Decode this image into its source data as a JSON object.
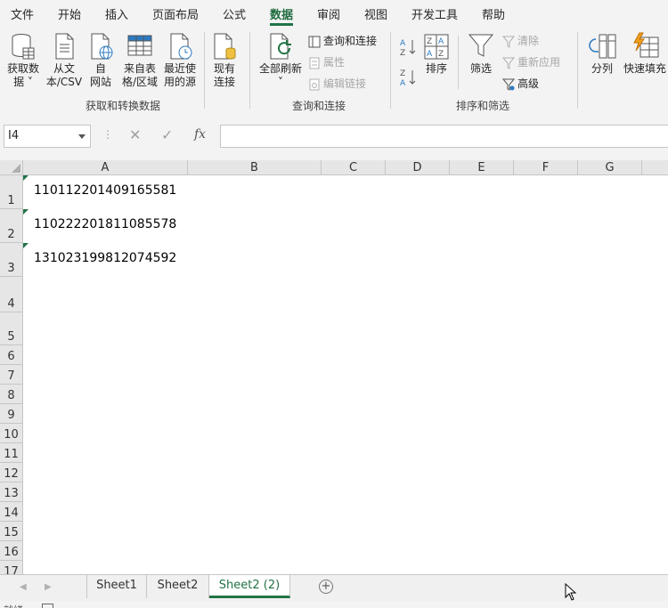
{
  "menu": {
    "tabs": [
      {
        "label": "文件"
      },
      {
        "label": "开始"
      },
      {
        "label": "插入"
      },
      {
        "label": "页面布局"
      },
      {
        "label": "公式"
      },
      {
        "label": "数据",
        "active": true
      },
      {
        "label": "审阅"
      },
      {
        "label": "视图"
      },
      {
        "label": "开发工具"
      },
      {
        "label": "帮助"
      }
    ]
  },
  "ribbon": {
    "get_transform": {
      "group_label": "获取和转换数据",
      "get_data": {
        "line1": "获取数",
        "line2": "据 ˅"
      },
      "from_text": {
        "line1": "从文",
        "line2": "本/CSV"
      },
      "from_web": {
        "line1": "自",
        "line2": "网站"
      },
      "from_table": {
        "line1": "来自表",
        "line2": "格/区域"
      },
      "recent_sources": {
        "line1": "最近使",
        "line2": "用的源"
      },
      "existing": {
        "line1": "现有",
        "line2": "连接"
      }
    },
    "queries": {
      "group_label": "查询和连接",
      "refresh_all": {
        "line1": "全部刷新",
        "line2": "˅"
      },
      "queries_connections": "查询和连接",
      "properties": "属性",
      "edit_links": "编辑链接"
    },
    "sort_filter": {
      "group_label": "排序和筛选",
      "sort": "排序",
      "filter": "筛选",
      "clear": "清除",
      "reapply": "重新应用",
      "advanced": "高级"
    },
    "data_tools": {
      "text_to_columns": "分列",
      "flash_fill": "快速填充"
    }
  },
  "formula_bar": {
    "name_box": "I4",
    "dots": "⋮",
    "cancel": "✕",
    "enter": "✓",
    "fx": "fx",
    "formula": ""
  },
  "grid": {
    "columns": [
      "A",
      "B",
      "C",
      "D",
      "E",
      "F",
      "G"
    ],
    "rows": [
      "1",
      "2",
      "3",
      "4",
      "5",
      "6",
      "7",
      "8",
      "9",
      "10",
      "11",
      "12",
      "13",
      "14",
      "15",
      "16",
      "17"
    ],
    "cells": {
      "A1": "110112201409165581",
      "A2": "110222201811085578",
      "A3": "131023199812074592"
    }
  },
  "sheets": {
    "tabs": [
      {
        "label": "Sheet1"
      },
      {
        "label": "Sheet2"
      },
      {
        "label": "Sheet2 (2)",
        "active": true
      }
    ],
    "add": "+"
  },
  "status": {
    "text": "就绪"
  }
}
